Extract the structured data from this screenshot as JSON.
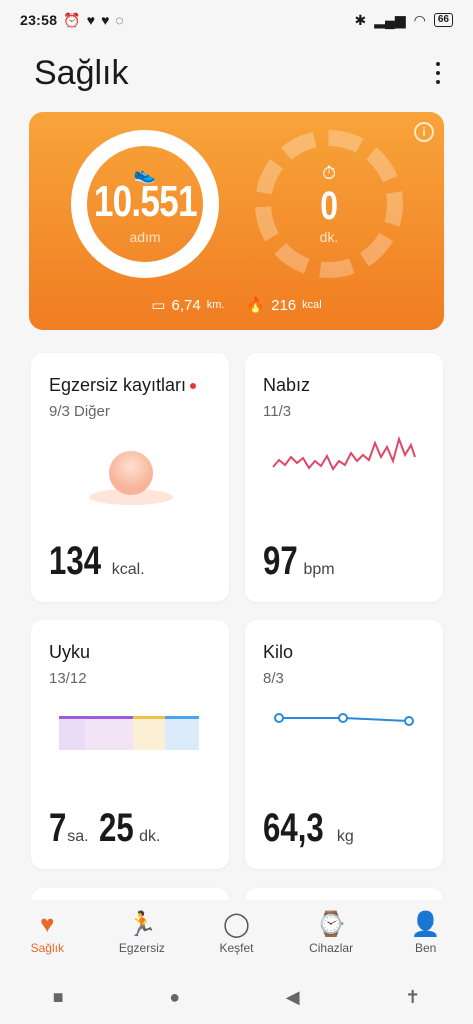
{
  "status": {
    "time": "23:58",
    "battery": "66"
  },
  "header": {
    "title": "Sağlık"
  },
  "hero": {
    "steps": "10.551",
    "steps_unit": "adım",
    "minutes": "0",
    "minutes_unit": "dk.",
    "distance": "6,74",
    "distance_unit": "km.",
    "calories": "216",
    "calories_unit": "kcal",
    "accent": "#f07d22"
  },
  "cards": {
    "exercise": {
      "title": "Egzersiz kayıtları",
      "sub": "9/3 Diğer",
      "value": "134",
      "unit": "kcal."
    },
    "pulse": {
      "title": "Nabız",
      "sub": "11/3",
      "value": "97",
      "unit": "bpm"
    },
    "sleep": {
      "title": "Uyku",
      "sub": "13/12",
      "hours": "7",
      "hours_unit": "sa.",
      "minutes": "25",
      "minutes_unit": "dk."
    },
    "weight": {
      "title": "Kilo",
      "sub": "8/3",
      "value": "64,3",
      "unit": "kg"
    }
  },
  "nav": {
    "items": [
      {
        "label": "Sağlık",
        "icon": "heart-pulse-icon"
      },
      {
        "label": "Egzersiz",
        "icon": "runner-icon"
      },
      {
        "label": "Keşfet",
        "icon": "planet-icon"
      },
      {
        "label": "Cihazlar",
        "icon": "watch-icon"
      },
      {
        "label": "Ben",
        "icon": "person-icon"
      }
    ]
  }
}
